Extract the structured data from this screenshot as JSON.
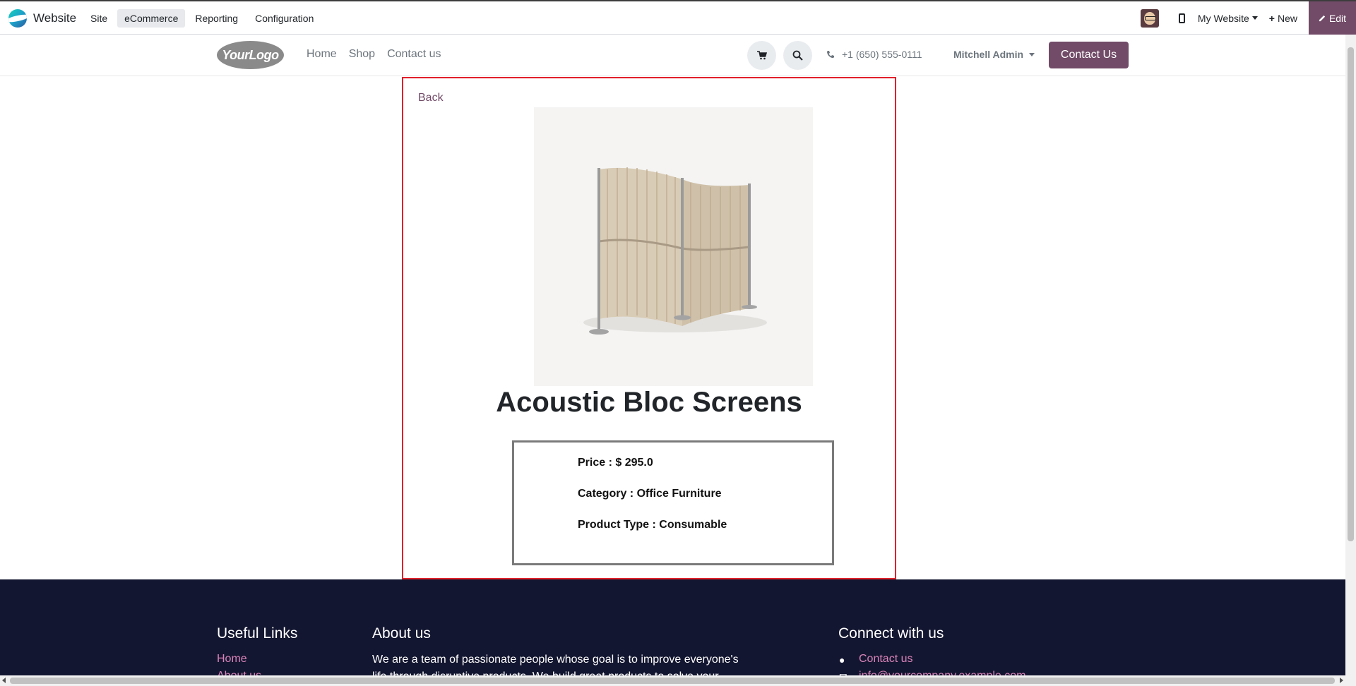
{
  "topbar": {
    "app_name": "Website",
    "menu": [
      "Site",
      "eCommerce",
      "Reporting",
      "Configuration"
    ],
    "active_menu": "eCommerce",
    "website_selector": "My Website",
    "new_label": "New",
    "edit_label": "Edit"
  },
  "site_header": {
    "logo_text": "YourLogo",
    "nav": [
      "Home",
      "Shop",
      "Contact us"
    ],
    "phone": "+1 (650) 555-0111",
    "user": "Mitchell Admin",
    "contact_button": "Contact Us"
  },
  "product": {
    "back_label": "Back",
    "title": "Acoustic Bloc Screens",
    "price_line": "Price : $ 295.0",
    "category_line": "Category : Office Furniture",
    "type_line": "Product Type : Consumable"
  },
  "footer": {
    "useful_links_heading": "Useful Links",
    "useful_links": [
      "Home",
      "About us"
    ],
    "about_heading": "About us",
    "about_text": "We are a team of passionate people whose goal is to improve everyone's life through disruptive products. We build great products to solve your",
    "connect_heading": "Connect with us",
    "connect_links": [
      "Contact us",
      "info@yourcompany.example.com"
    ]
  },
  "colors": {
    "brand": "#714b67",
    "highlight_border": "#e0202a",
    "footer_bg": "#131630",
    "footer_link": "#d883b9"
  }
}
